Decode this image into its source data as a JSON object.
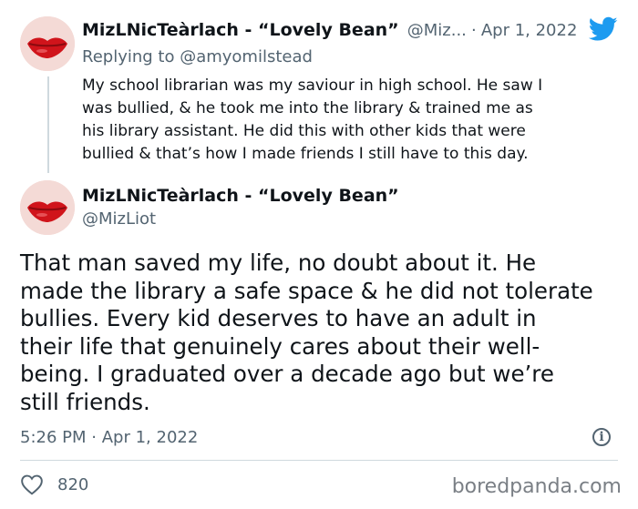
{
  "reply_tweet": {
    "display_name": "MizLNicTeàrlach - “Lovely Bean”",
    "handle": "@Miz...",
    "separator": "·",
    "date": "Apr 1, 2022",
    "replying_to_prefix": "Replying to ",
    "replying_to_handle": "@amyomilstead",
    "text_lines": [
      "My school librarian was my saviour in high school. He saw I",
      "was bullied, & he took me into the library & trained me as",
      "his library assistant. He did this with other kids that were",
      "bullied & that’s how I made friends I still have to this day."
    ]
  },
  "main_tweet": {
    "display_name": "MizLNicTeàrlach - “Lovely Bean”",
    "handle": "@MizLiot",
    "text_lines": [
      "That man saved my life, no doubt about it. He",
      "made the library a safe space & he did not tolerate",
      "bullies. Every kid deserves to have an adult in",
      "their life that genuinely cares about their well-",
      "being. I graduated over a decade ago but we’re",
      "still friends."
    ],
    "time": "5:26 PM",
    "separator": "·",
    "date": "Apr 1, 2022",
    "like_count": "820"
  },
  "watermark": "boredpanda.com",
  "colors": {
    "twitter_blue": "#1d9bf0",
    "muted_text": "#536471",
    "lips_red": "#d0141b",
    "skin": "#f4dad6",
    "divider": "#cfd9de"
  },
  "icons": [
    "twitter-bird-icon",
    "info-icon",
    "heart-icon"
  ]
}
